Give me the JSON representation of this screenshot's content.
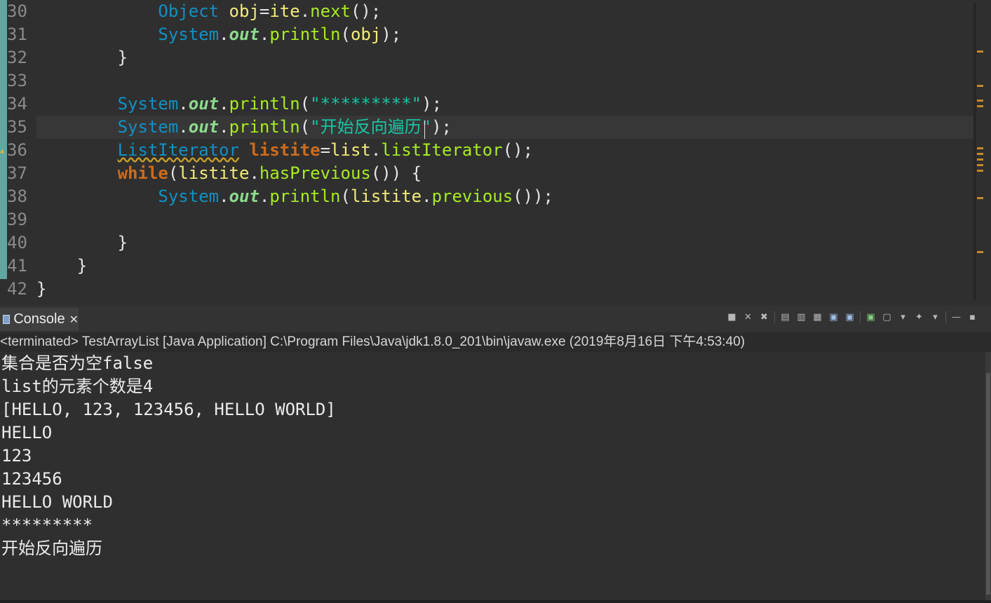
{
  "editor": {
    "lines": [
      {
        "n": "30",
        "tokens": [
          {
            "t": "            "
          },
          {
            "t": "Object",
            "c": "type"
          },
          {
            "t": " "
          },
          {
            "t": "obj",
            "c": "var"
          },
          {
            "t": "="
          },
          {
            "t": "ite",
            "c": "var"
          },
          {
            "t": "."
          },
          {
            "t": "next",
            "c": "method"
          },
          {
            "t": "();"
          }
        ]
      },
      {
        "n": "31",
        "tokens": [
          {
            "t": "            "
          },
          {
            "t": "System",
            "c": "type"
          },
          {
            "t": "."
          },
          {
            "t": "out",
            "c": "field-static"
          },
          {
            "t": "."
          },
          {
            "t": "println",
            "c": "method"
          },
          {
            "t": "("
          },
          {
            "t": "obj",
            "c": "var"
          },
          {
            "t": ");"
          }
        ]
      },
      {
        "n": "32",
        "tokens": [
          {
            "t": "        }"
          }
        ]
      },
      {
        "n": "33",
        "tokens": []
      },
      {
        "n": "34",
        "tokens": [
          {
            "t": "        "
          },
          {
            "t": "System",
            "c": "type"
          },
          {
            "t": "."
          },
          {
            "t": "out",
            "c": "field-static"
          },
          {
            "t": "."
          },
          {
            "t": "println",
            "c": "method"
          },
          {
            "t": "("
          },
          {
            "t": "\"*********\"",
            "c": "str"
          },
          {
            "t": ");"
          }
        ]
      },
      {
        "n": "35",
        "current": true,
        "tokens": [
          {
            "t": "        "
          },
          {
            "t": "System",
            "c": "type"
          },
          {
            "t": "."
          },
          {
            "t": "out",
            "c": "field-static"
          },
          {
            "t": "."
          },
          {
            "t": "println",
            "c": "method"
          },
          {
            "t": "("
          },
          {
            "t": "\"开始反向遍历\"",
            "c": "str"
          },
          {
            "t": ");"
          }
        ]
      },
      {
        "n": "36",
        "tokens": [
          {
            "t": "        "
          },
          {
            "t": "ListIterator",
            "c": "type-warn"
          },
          {
            "t": " "
          },
          {
            "t": "listite",
            "c": "kw"
          },
          {
            "t": "="
          },
          {
            "t": "list",
            "c": "var"
          },
          {
            "t": "."
          },
          {
            "t": "listIterator",
            "c": "method"
          },
          {
            "t": "();"
          }
        ]
      },
      {
        "n": "37",
        "tokens": [
          {
            "t": "        "
          },
          {
            "t": "while",
            "c": "kw"
          },
          {
            "t": "("
          },
          {
            "t": "listite",
            "c": "var"
          },
          {
            "t": "."
          },
          {
            "t": "hasPrevious",
            "c": "method"
          },
          {
            "t": "()) {"
          }
        ]
      },
      {
        "n": "38",
        "tokens": [
          {
            "t": "            "
          },
          {
            "t": "System",
            "c": "type"
          },
          {
            "t": "."
          },
          {
            "t": "out",
            "c": "field-static"
          },
          {
            "t": "."
          },
          {
            "t": "println",
            "c": "method"
          },
          {
            "t": "("
          },
          {
            "t": "listite",
            "c": "var"
          },
          {
            "t": "."
          },
          {
            "t": "previous",
            "c": "method"
          },
          {
            "t": "());"
          }
        ]
      },
      {
        "n": "39",
        "tokens": []
      },
      {
        "n": "40",
        "tokens": [
          {
            "t": "        }"
          }
        ]
      },
      {
        "n": "41",
        "tokens": [
          {
            "t": "    }"
          }
        ]
      },
      {
        "n": "42",
        "tokens": [
          {
            "t": "}"
          }
        ]
      }
    ]
  },
  "console": {
    "tab_label": "Console",
    "tab_close": "✕",
    "status": "<terminated> TestArrayList [Java Application] C:\\Program Files\\Java\\jdk1.8.0_201\\bin\\javaw.exe (2019年8月16日 下午4:53:40)",
    "output": [
      "集合是否为空false",
      "list的元素个数是4",
      "[HELLO, 123, 123456, HELLO WORLD]",
      "HELLO",
      "123",
      "123456",
      "HELLO WORLD",
      "*********",
      "开始反向遍历"
    ],
    "toolbar": [
      {
        "name": "terminate-icon",
        "glyph": "■"
      },
      {
        "name": "remove-launch-icon",
        "glyph": "✕"
      },
      {
        "name": "remove-all-terminated-icon",
        "glyph": "✖"
      },
      {
        "name": "scroll-lock-icon",
        "glyph": "▤"
      },
      {
        "name": "word-wrap-icon",
        "glyph": "▥"
      },
      {
        "name": "show-on-output-icon",
        "glyph": "▦"
      },
      {
        "name": "show-stdout-icon",
        "glyph": "▣",
        "tone": "blue"
      },
      {
        "name": "show-stderr-icon",
        "glyph": "▣",
        "tone": "blue"
      },
      {
        "name": "pin-console-icon",
        "glyph": "▣",
        "tone": "green"
      },
      {
        "name": "display-selected-console-icon",
        "glyph": "▢"
      },
      {
        "name": "display-console-dropdown-icon",
        "glyph": "▾"
      },
      {
        "name": "open-console-icon",
        "glyph": "✦"
      },
      {
        "name": "open-console-dropdown-icon",
        "glyph": "▾"
      },
      {
        "name": "minimize-icon",
        "glyph": "—"
      },
      {
        "name": "maximize-icon",
        "glyph": "▪"
      }
    ]
  },
  "colors": {
    "keyword": "#cc6c1d",
    "type": "#1290c3",
    "string": "#17c6a3",
    "method": "#a7ec21",
    "variable": "#f3ec79",
    "field": "#8dda8d",
    "editor_bg": "#2f2f2f"
  }
}
